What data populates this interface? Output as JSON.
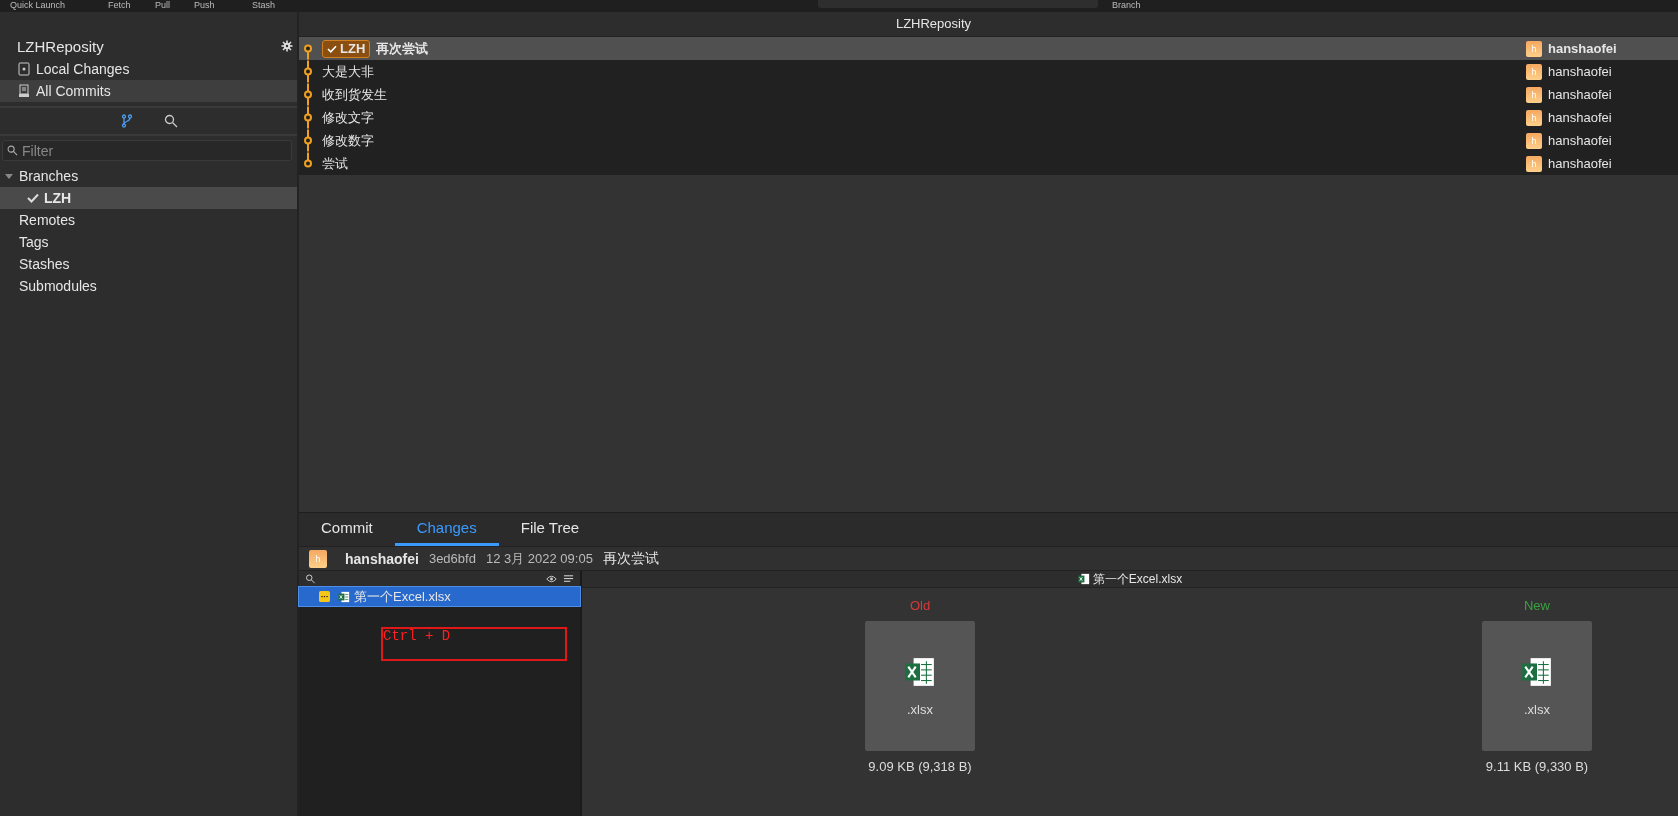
{
  "toolbar": [
    "Quick Launch",
    "Fetch",
    "Pull",
    "Push",
    "Stash",
    "Branch"
  ],
  "sidebar": {
    "repo": "LZHReposity",
    "views": [
      {
        "label": "Local Changes",
        "kind": "local",
        "selected": false
      },
      {
        "label": "All Commits",
        "kind": "commits",
        "selected": true
      }
    ],
    "modes": [
      {
        "kind": "branch",
        "selected": true
      },
      {
        "kind": "search",
        "selected": false
      }
    ],
    "filter": {
      "placeholder": "Filter"
    },
    "tree": [
      {
        "label": "Branches",
        "expanded": true,
        "children": [
          {
            "label": "LZH",
            "current": true,
            "selected": true
          }
        ]
      },
      {
        "label": "Remotes"
      },
      {
        "label": "Tags"
      },
      {
        "label": "Stashes"
      },
      {
        "label": "Submodules"
      }
    ]
  },
  "window": {
    "title": "LZHReposity"
  },
  "commits": [
    {
      "message": "再次尝试",
      "branch": "LZH",
      "author": "hanshaofei",
      "avatar": "h",
      "selected": true
    },
    {
      "message": "大是大非",
      "author": "hanshaofei",
      "avatar": "h",
      "selected": false
    },
    {
      "message": "收到货发生",
      "author": "hanshaofei",
      "avatar": "h",
      "selected": false
    },
    {
      "message": "修改文字",
      "author": "hanshaofei",
      "avatar": "h",
      "selected": false
    },
    {
      "message": "修改数字",
      "author": "hanshaofei",
      "avatar": "h",
      "selected": false
    },
    {
      "message": "尝试",
      "author": "hanshaofei",
      "avatar": "h",
      "selected": false
    }
  ],
  "detail_tabs": [
    {
      "label": "Commit",
      "selected": false
    },
    {
      "label": "Changes",
      "selected": true
    },
    {
      "label": "File Tree",
      "selected": false
    }
  ],
  "commit_info": {
    "avatar": "h",
    "author": "hanshaofei",
    "hash": "3ed6bfd",
    "date": "12 3月 2022 09:05",
    "message": "再次尝试"
  },
  "files": [
    {
      "name": "第一个Excel.xlsx",
      "selected": true
    }
  ],
  "annotation": "Ctrl + D",
  "diff": {
    "file": "第一个Excel.xlsx",
    "sides": [
      {
        "label": "Old",
        "kind": "old",
        "ext": ".xlsx",
        "size": "9.09 KB (9,318 B)"
      },
      {
        "label": "New",
        "kind": "new",
        "ext": ".xlsx",
        "size": "9.11 KB (9,330 B)"
      }
    ]
  }
}
